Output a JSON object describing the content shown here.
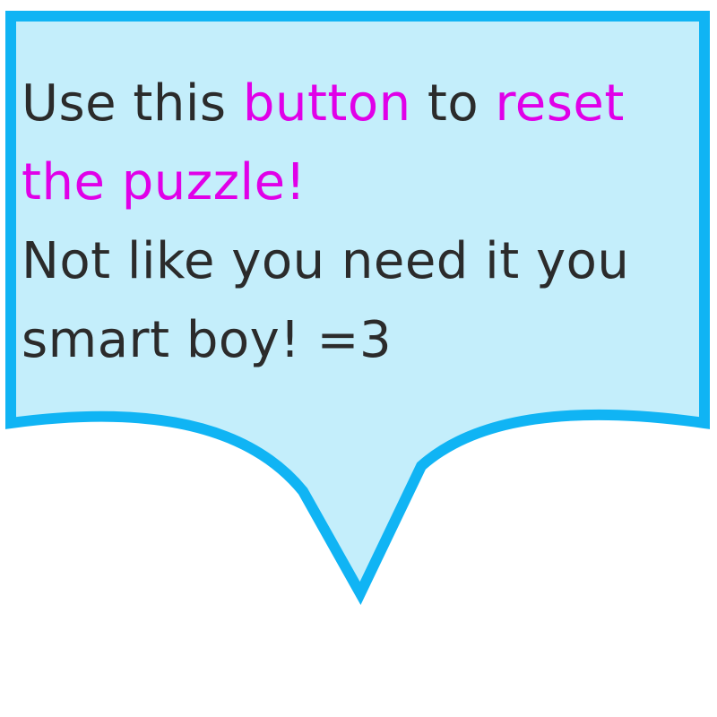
{
  "tooltip": {
    "seg1": "Use this ",
    "seg2": "button",
    "seg3": " to ",
    "seg4": "reset",
    "seg5": "the puzzle!",
    "line3": "Not like you need it you",
    "line4": "smart boy! =3"
  },
  "colors": {
    "bubble_fill": "#c4eefb",
    "bubble_border": "#10b4f4",
    "text": "#2b2b2b",
    "highlight": "#e000e8"
  }
}
